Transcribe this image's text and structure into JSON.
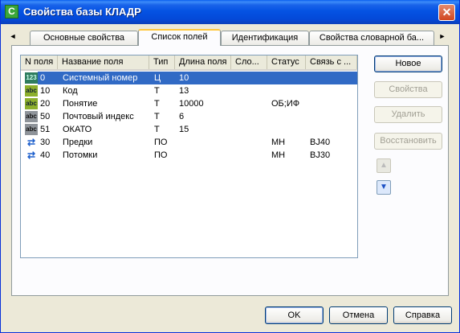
{
  "window": {
    "title": "Свойства базы КЛАДР",
    "app_icon": "C",
    "close_glyph": "✕"
  },
  "tabs": {
    "scroll_left": "◄",
    "scroll_right": "►",
    "items": [
      {
        "label": "Основные свойства",
        "active": false
      },
      {
        "label": "Список полей",
        "active": true
      },
      {
        "label": "Идентификация",
        "active": false
      },
      {
        "label": "Свойства словарной ба...",
        "active": false
      }
    ]
  },
  "table": {
    "columns": [
      "N поля",
      "Название поля",
      "Тип",
      "Длина поля",
      "Сло...",
      "Статус",
      "Связь с ..."
    ],
    "rows": [
      {
        "icon": "num",
        "icon_text": "123",
        "n": "0",
        "name": "Системный номер",
        "type": "Ц",
        "length": "10",
        "slo": "",
        "status": "",
        "link": "",
        "selected": true
      },
      {
        "icon": "abc",
        "icon_text": "abc",
        "n": "10",
        "name": "Код",
        "type": "Т",
        "length": "13",
        "slo": "",
        "status": "",
        "link": "",
        "selected": false
      },
      {
        "icon": "abc",
        "icon_text": "abc",
        "n": "20",
        "name": "Понятие",
        "type": "Т",
        "length": "10000",
        "slo": "",
        "status": "ОБ;ИФ",
        "link": "",
        "selected": false
      },
      {
        "icon": "abcg",
        "icon_text": "abc",
        "n": "50",
        "name": "Почтовый индекс",
        "type": "Т",
        "length": "6",
        "slo": "",
        "status": "",
        "link": "",
        "selected": false
      },
      {
        "icon": "abcg",
        "icon_text": "abc",
        "n": "51",
        "name": "ОКАТО",
        "type": "Т",
        "length": "15",
        "slo": "",
        "status": "",
        "link": "",
        "selected": false
      },
      {
        "icon": "link",
        "icon_text": "⇄",
        "n": "30",
        "name": "Предки",
        "type": "ПО",
        "length": "",
        "slo": "",
        "status": "МН",
        "link": "BJ40",
        "selected": false
      },
      {
        "icon": "link",
        "icon_text": "⇄",
        "n": "40",
        "name": "Потомки",
        "type": "ПО",
        "length": "",
        "slo": "",
        "status": "МН",
        "link": "BJ30",
        "selected": false
      }
    ]
  },
  "side_buttons": {
    "new": "Новое",
    "properties": "Свойства",
    "delete": "Удалить",
    "restore": "Восстановить",
    "move_up": "▲",
    "move_down": "▼"
  },
  "footer": {
    "ok": "OK",
    "cancel": "Отмена",
    "help": "Справка"
  },
  "colors": {
    "selection": "#316ac5",
    "titlebar": "#0553e3"
  }
}
